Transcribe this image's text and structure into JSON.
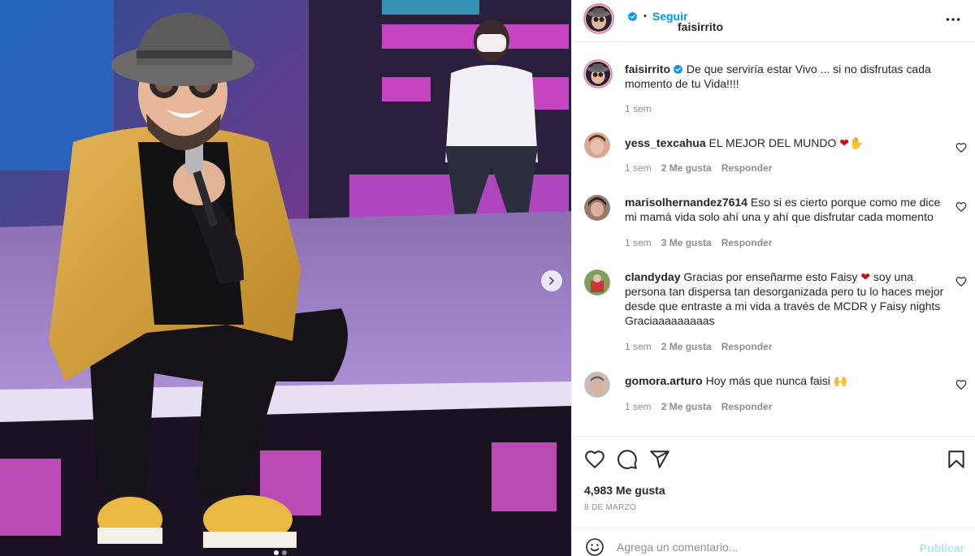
{
  "post": {
    "username": "faisirrito",
    "verified": true,
    "follow_label": "Seguir",
    "separator": "•",
    "caption_username": "faisirrito",
    "caption_text": "De que serviría estar Vivo ... si no disfrutas cada momento de tu Vida!!!!",
    "caption_time": "1 sem",
    "media_dots": 2,
    "active_dot": 0
  },
  "comments": [
    {
      "username": "yess_texcahua",
      "text": "EL MEJOR DEL MUNDO",
      "emoji": "❤✋",
      "time": "1 sem",
      "likes": "2 Me gusta",
      "reply": "Responder",
      "avatar_color": "#c98a78"
    },
    {
      "username": "marisolhernandez7614",
      "text": "Eso si es cierto porque como me dice mi mamá vida solo ahí una y ahí que disfrutar cada momento",
      "time": "1 sem",
      "likes": "3 Me gusta",
      "reply": "Responder",
      "avatar_color": "#8a6a5c"
    },
    {
      "username": "clandyday",
      "text_before": "Gracias por enseñarme esto Faisy",
      "emoji": "❤",
      "text_after": "soy una persona tan dispersa tan desorganizada pero tu lo haces mejor desde que entraste a mi vida a través de MCDR y Faisy nights Graciaaaaaaaaas",
      "time": "1 sem",
      "likes": "2 Me gusta",
      "reply": "Responder",
      "avatar_color": "#6a8a4a"
    },
    {
      "username": "gomora.arturo",
      "text": "Hoy más que nunca faisi",
      "emoji": "🙌",
      "time": "1 sem",
      "likes": "2 Me gusta",
      "reply": "Responder",
      "avatar_color": "#b9a9a0"
    }
  ],
  "actions": {
    "likes_count": "4,983 Me gusta",
    "date": "8 DE MARZO"
  },
  "composer": {
    "placeholder": "Agrega un comentario...",
    "publish_label": "Publicar"
  },
  "colors": {
    "accent": "#0095f6",
    "publish_disabled": "#b2dffc",
    "muted": "#8e8e8e",
    "heart_red": "#c0111f"
  },
  "icons": {
    "more": "more-horizontal-icon",
    "like": "heart-icon",
    "comment": "comment-icon",
    "share": "paper-plane-icon",
    "save": "bookmark-icon",
    "emoji": "smiley-icon",
    "next": "chevron-right-icon"
  }
}
